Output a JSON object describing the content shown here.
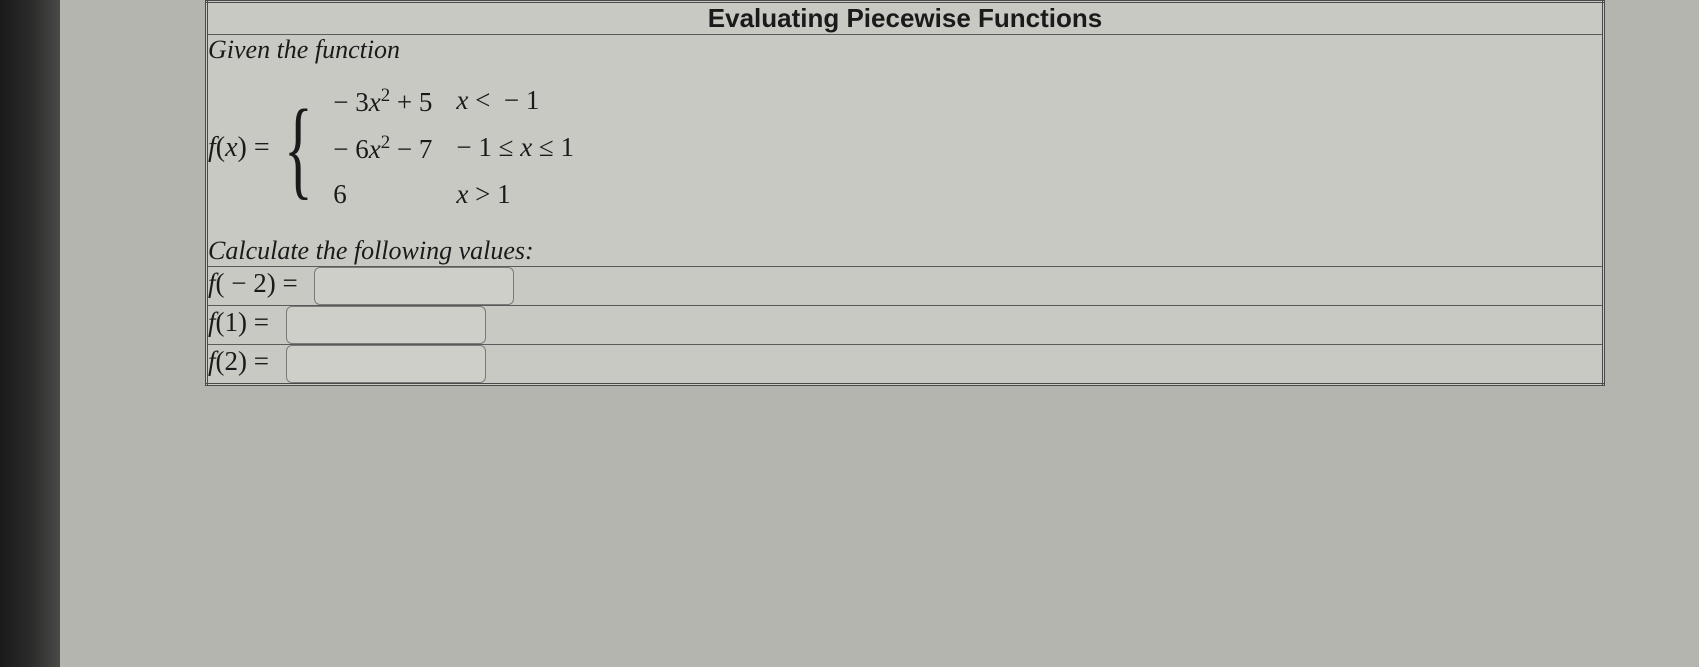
{
  "title": "Evaluating Piecewise Functions",
  "given_label": "Given the function",
  "function_lhs": "f(x) =",
  "pieces": [
    {
      "expr": "− 3x² + 5",
      "cond": "x < − 1"
    },
    {
      "expr": "− 6x² − 7",
      "cond": "− 1 ≤ x ≤ 1"
    },
    {
      "expr": "6",
      "cond": "x > 1"
    }
  ],
  "calculate_label": "Calculate the following values:",
  "prompts": [
    {
      "label": "f( − 2) =",
      "value": ""
    },
    {
      "label": "f(1) =",
      "value": ""
    },
    {
      "label": "f(2) =",
      "value": ""
    }
  ]
}
